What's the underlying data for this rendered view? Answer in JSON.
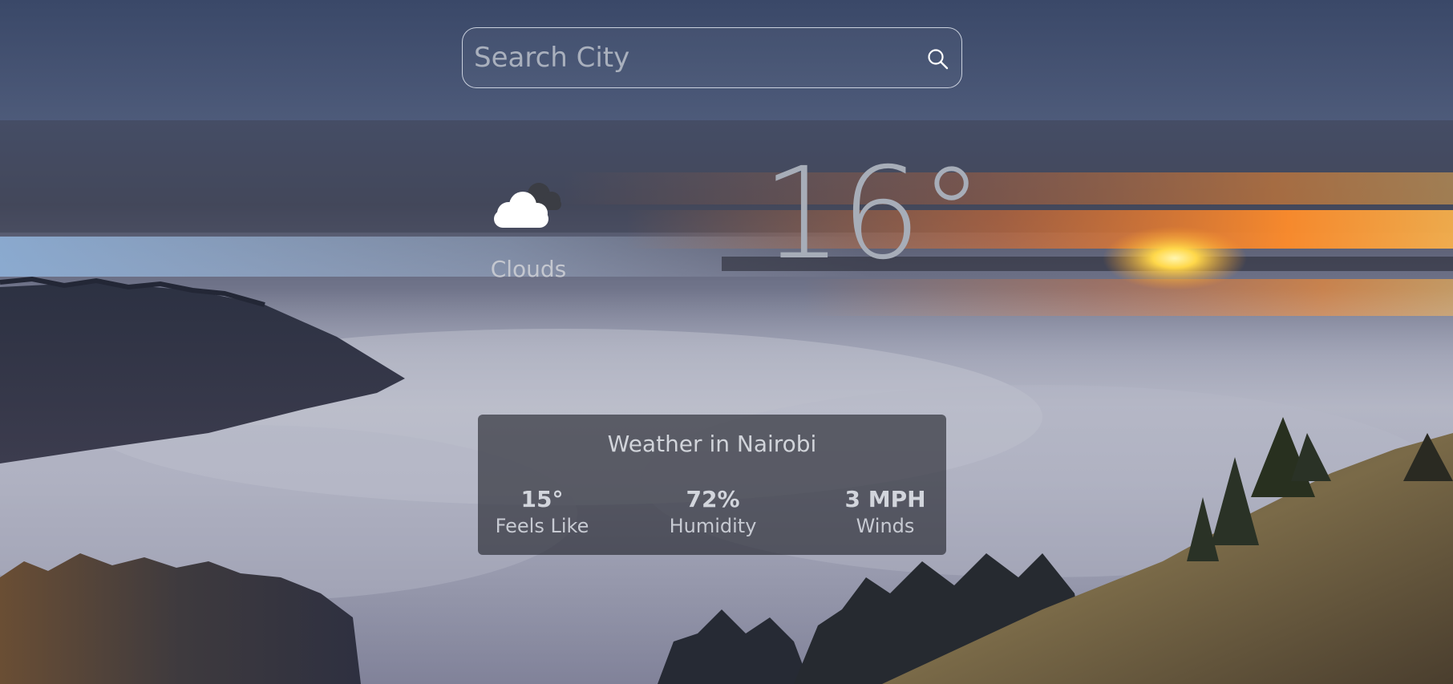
{
  "search": {
    "placeholder": "Search City",
    "icon": "search-icon"
  },
  "current": {
    "condition": "Clouds",
    "condition_icon": "cloud-icon",
    "temperature": "16°"
  },
  "details": {
    "title": "Weather in Nairobi",
    "stats": [
      {
        "value": "15°",
        "label": "Feels Like"
      },
      {
        "value": "72%",
        "label": "Humidity"
      },
      {
        "value": "3 MPH",
        "label": "Winds"
      }
    ]
  },
  "colors": {
    "sky_top": "#3f4c6b",
    "sunset_orange": "#f07a2a",
    "sun_yellow": "#ffd84a",
    "fog": "#b9bcc8",
    "card_bg": "#1e2028"
  }
}
